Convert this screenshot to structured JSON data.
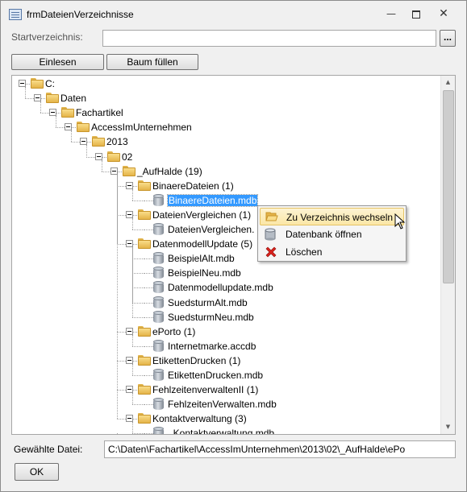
{
  "window": {
    "title": "frmDateienVerzeichnisse",
    "controls": [
      "minimize-icon",
      "restore-icon",
      "close-icon"
    ]
  },
  "form": {
    "startverzeichnis_label": "Startverzeichnis:",
    "startverzeichnis_value": "",
    "browse_label": "...",
    "einlesen_label": "Einlesen",
    "baum_fuellen_label": "Baum füllen",
    "gewaehlte_datei_label": "Gewählte Datei:",
    "gewaehlte_datei_value": "C:\\Daten\\Fachartikel\\AccessImUnternehmen\\2013\\02\\_AufHalde\\ePo",
    "ok_label": "OK"
  },
  "tree": {
    "nodes": [
      {
        "id": "n0",
        "label": "C:",
        "type": "folder"
      },
      {
        "id": "n1",
        "label": "Daten",
        "type": "folder"
      },
      {
        "id": "n2",
        "label": "Fachartikel",
        "type": "folder"
      },
      {
        "id": "n3",
        "label": "AccessImUnternehmen",
        "type": "folder"
      },
      {
        "id": "n4",
        "label": "2013",
        "type": "folder"
      },
      {
        "id": "n5",
        "label": "02",
        "type": "folder"
      },
      {
        "id": "n6",
        "label": "_AufHalde (19)",
        "type": "folder"
      },
      {
        "id": "n7",
        "label": "BinaereDateien (1)",
        "type": "folder"
      },
      {
        "id": "n8",
        "label": "BinaereDateien.mdb",
        "type": "file",
        "selected": true
      },
      {
        "id": "n9",
        "label": "DateienVergleichen (1)",
        "type": "folder"
      },
      {
        "id": "n10",
        "label": "DateienVergleichen.",
        "type": "file"
      },
      {
        "id": "n11",
        "label": "DatenmodellUpdate (5)",
        "type": "folder"
      },
      {
        "id": "n12",
        "label": "BeispielAlt.mdb",
        "type": "file"
      },
      {
        "id": "n13",
        "label": "BeispielNeu.mdb",
        "type": "file"
      },
      {
        "id": "n14",
        "label": "Datenmodellupdate.mdb",
        "type": "file"
      },
      {
        "id": "n15",
        "label": "SuedsturmAlt.mdb",
        "type": "file"
      },
      {
        "id": "n16",
        "label": "SuedsturmNeu.mdb",
        "type": "file"
      },
      {
        "id": "n17",
        "label": "ePorto (1)",
        "type": "folder"
      },
      {
        "id": "n18",
        "label": "Internetmarke.accdb",
        "type": "file"
      },
      {
        "id": "n19",
        "label": "EtikettenDrucken (1)",
        "type": "folder"
      },
      {
        "id": "n20",
        "label": "EtikettenDrucken.mdb",
        "type": "file"
      },
      {
        "id": "n21",
        "label": "FehlzeitenverwaltenII (1)",
        "type": "folder"
      },
      {
        "id": "n22",
        "label": "FehlzeitenVerwalten.mdb",
        "type": "file"
      },
      {
        "id": "n23",
        "label": "Kontaktverwaltung (3)",
        "type": "folder"
      },
      {
        "id": "n24",
        "label": "_Kontaktverwaltung.mdb",
        "type": "file"
      }
    ]
  },
  "context_menu": {
    "items": [
      {
        "label": "Zu Verzeichnis wechseln",
        "icon": "folder-open-icon",
        "highlighted": true
      },
      {
        "label": "Datenbank öffnen",
        "icon": "database-icon",
        "highlighted": false
      },
      {
        "label": "Löschen",
        "icon": "delete-x-icon",
        "highlighted": false
      }
    ]
  },
  "colors": {
    "selection": "#3399ff",
    "menu_highlight": "#fbe7a6",
    "delete_red": "#d9221c"
  }
}
